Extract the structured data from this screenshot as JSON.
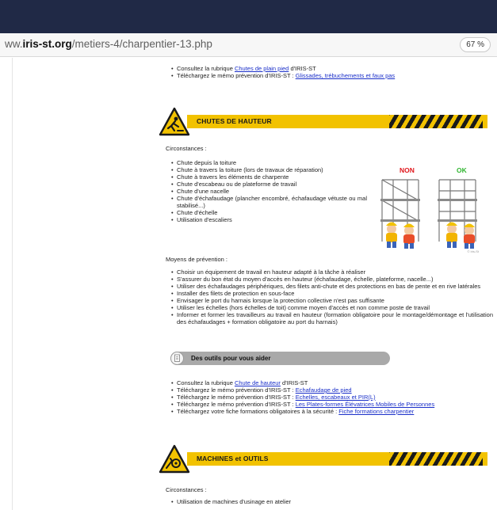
{
  "browser": {
    "url_prefix": "ww.",
    "url_domain": "iris-st.org",
    "url_path": "/metiers-4/charpentier-13.php",
    "zoom": "67 %"
  },
  "intro_list": [
    {
      "text": "Consultez la rubrique ",
      "link": "Chutes de plain pied",
      "suffix": " d'IRIS-ST"
    },
    {
      "text": "Téléchargez le mémo prévention d'IRIS-ST : ",
      "link": "Glissades, trébuchements et faux pas",
      "suffix": ""
    }
  ],
  "section_falls": {
    "title": "CHUTES DE HAUTEUR",
    "circumstances_label": "Circonstances :",
    "circumstances": [
      "Chute depuis la toiture",
      "Chute à travers la toiture (lors de travaux de réparation)",
      "Chute à travers les éléments de charpente",
      "Chute d'escabeau ou de plateforme de travail",
      "Chute d'une nacelle",
      "Chute d'échafaudage (plancher encombré, échafaudage vétuste ou mal stabilisé...)",
      "Chute d'échelle",
      "Utilisation d'escaliers"
    ],
    "illustration": {
      "non_label": "NON",
      "ok_label": "OK",
      "credit": "© Iris-St"
    },
    "prevention_label": "Moyens de prévention :",
    "prevention": [
      "Choisir un équipement de travail en hauteur adapté à la tâche à réaliser",
      "S'assurer du bon état du moyen d'accès en hauteur (échafaudage, échelle, plateforme, nacelle...)",
      "Utiliser des échafaudages périphériques, des filets anti-chute et des protections en bas de pente et en rive latérales",
      "Installer des filets de protection en sous-face",
      "Envisager le port du harnais lorsque la protection collective n'est pas suffisante",
      "Utiliser les échelles (hors échelles de toit) comme moyen d'accès et non comme poste de travail",
      "Informer et former les travailleurs au travail en hauteur (formation obligatoire pour le montage/démontage et l'utilisation des échafaudages + formation obligatoire au port du harnais)"
    ]
  },
  "tools": {
    "title": "Des outils pour vous aider",
    "items": [
      {
        "text": "Consultez la rubrique ",
        "link": "Chute de hauteur",
        "suffix": " d'IRIS-ST"
      },
      {
        "text": "Téléchargez le mémo prévention d'IRIS-ST : ",
        "link": "Echafaudage de pied",
        "suffix": ""
      },
      {
        "text": "Téléchargez le mémo prévention d'IRIS-ST : ",
        "link": "Echelles, escabeaux et PIR(L)",
        "suffix": ""
      },
      {
        "text": "Téléchargez le mémo prévention d'IRIS-ST : ",
        "link": "Les Plates-formes Élévatrices Mobiles de Personnes",
        "suffix": ""
      },
      {
        "text": "Téléchargez votre fiche formations obligatoires à la sécurité : ",
        "link": "Fiche formations charpentier",
        "suffix": ""
      }
    ]
  },
  "section_machines": {
    "title": "MACHINES et OUTILS",
    "circumstances_label": "Circonstances :",
    "circumstances": [
      "Utilisation de machines d'usinage en atelier"
    ]
  },
  "colors": {
    "banner_yellow": "#f2c200",
    "header_navy": "#202946",
    "link_blue": "#1a2fc9"
  }
}
